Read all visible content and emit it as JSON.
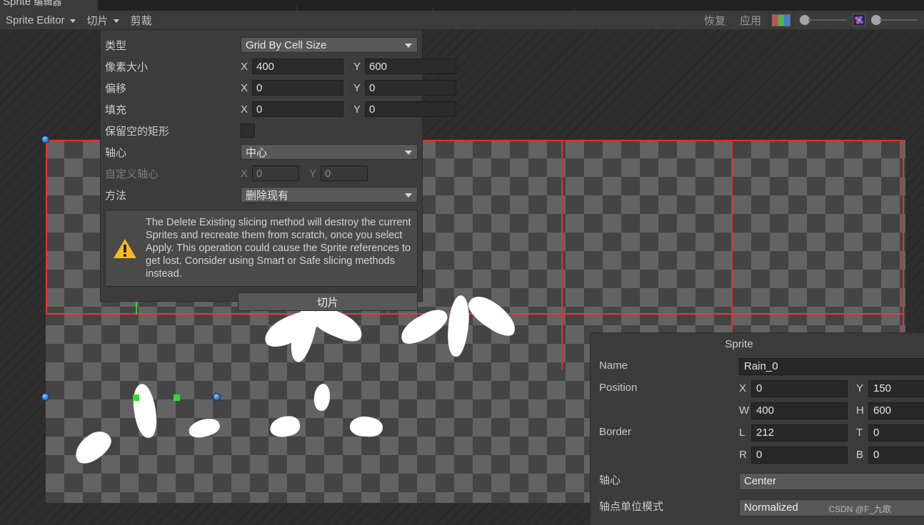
{
  "window": {
    "tab_label_en": "Sprite",
    "tab_label_cn": "编辑器"
  },
  "toolbar": {
    "editor_menu": "Sprite Editor",
    "slice_menu": "切片",
    "trim_button": "剪裁",
    "revert_button": "恢复",
    "apply_button": "应用",
    "rgb_icon": "rgb-channel-icon",
    "noise_icon": "alpha-noise-icon",
    "colors": {
      "red": "#d24a4a",
      "green": "#4ab84a",
      "blue": "#4a7ad2"
    }
  },
  "slice_panel": {
    "type": {
      "label": "类型",
      "value": "Grid By Cell Size"
    },
    "pixel_size": {
      "label": "像素大小",
      "x_label": "X",
      "x": "400",
      "y_label": "Y",
      "y": "600"
    },
    "offset": {
      "label": "偏移",
      "x_label": "X",
      "x": "0",
      "y_label": "Y",
      "y": "0"
    },
    "padding": {
      "label": "填充",
      "x_label": "X",
      "x": "0",
      "y_label": "Y",
      "y": "0"
    },
    "keep_empty": {
      "label": "保留空的矩形",
      "checked": false
    },
    "pivot": {
      "label": "轴心",
      "value": "中心"
    },
    "custom_pivot": {
      "label": "自定义轴心",
      "x_label": "X",
      "x": "0",
      "y_label": "Y",
      "y": "0",
      "disabled": true
    },
    "method": {
      "label": "方法",
      "value": "删除现有"
    },
    "warning": {
      "icon": "warning-triangle-icon",
      "color": "#f5bb1d",
      "text": "The Delete Existing slicing method will destroy the current Sprites and recreate them from scratch, once you select Apply. This operation could cause the Sprite references to get lost. Consider using Smart or Safe slicing methods instead."
    },
    "slice_button": "切片"
  },
  "sprite_panel": {
    "title": "Sprite",
    "name": {
      "label": "Name",
      "value": "Rain_0"
    },
    "position": {
      "label": "Position",
      "x_label": "X",
      "x": "0",
      "y_label": "Y",
      "y": "150",
      "w_label": "W",
      "w": "400",
      "h_label": "H",
      "h": "600"
    },
    "border": {
      "label": "Border",
      "l_label": "L",
      "l": "212",
      "t_label": "T",
      "t": "0",
      "r_label": "R",
      "r": "0",
      "b_label": "B",
      "b": "0"
    },
    "pivot": {
      "label": "轴心",
      "value": "Center"
    },
    "pivot_unit_mode": {
      "label": "轴点单位模式",
      "value": "Normalized"
    }
  },
  "canvas": {
    "selection_color": "#ff2f2f",
    "slice_line_color": "#e03030",
    "border_guide_color": "#33d033",
    "handle_color": "#2f7fe8",
    "checker_light": "#636363",
    "checker_dark": "#444444"
  },
  "watermark": "CSDN @F_九歌"
}
